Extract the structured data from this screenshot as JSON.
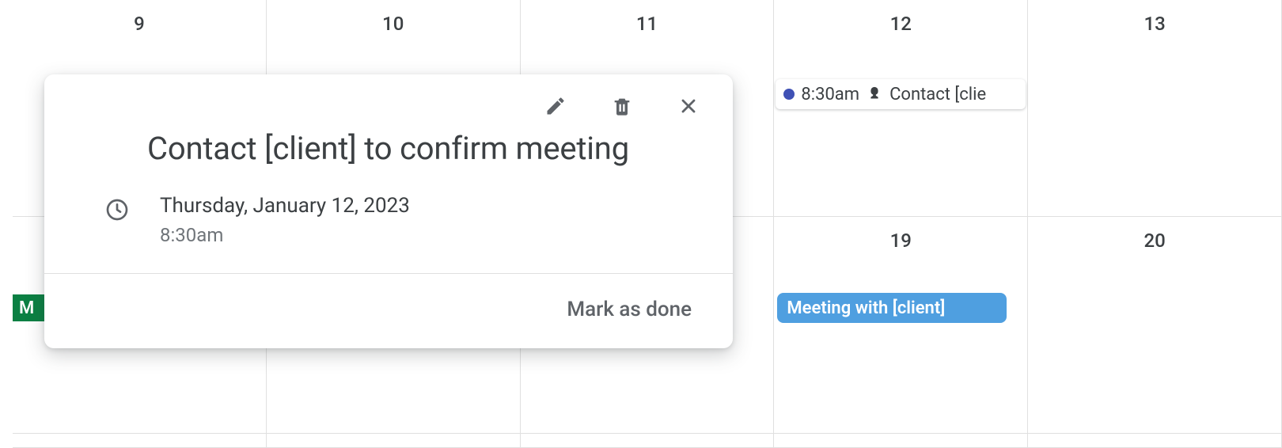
{
  "calendar": {
    "week1": [
      "9",
      "10",
      "11",
      "12",
      "13"
    ],
    "week2_visible": {
      "c3": "19",
      "c4": "20"
    }
  },
  "event_task": {
    "time": "8:30am",
    "title": "Contact [clie"
  },
  "event_meeting": {
    "title": "Meeting with [client]"
  },
  "event_green_partial": "M",
  "popover": {
    "title": "Contact [client] to confirm meeting",
    "date": "Thursday, January 12, 2023",
    "time": "8:30am",
    "mark_done": "Mark as done"
  }
}
